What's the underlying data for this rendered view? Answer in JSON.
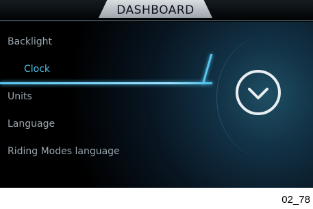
{
  "header": {
    "title": "DASHBOARD"
  },
  "menu": {
    "items": [
      {
        "label": "Backlight",
        "selected": false
      },
      {
        "label": "Clock",
        "selected": true
      },
      {
        "label": "Units",
        "selected": false
      },
      {
        "label": "Language",
        "selected": false
      },
      {
        "label": "Riding Modes language",
        "selected": false
      }
    ]
  },
  "preview": {
    "icon": "clock-icon"
  },
  "footer": {
    "code": "02_78"
  },
  "colors": {
    "accent": "#4fbfe8",
    "text": "#9aa7af",
    "background": "#000000",
    "title_bg": "#c9ced2"
  }
}
